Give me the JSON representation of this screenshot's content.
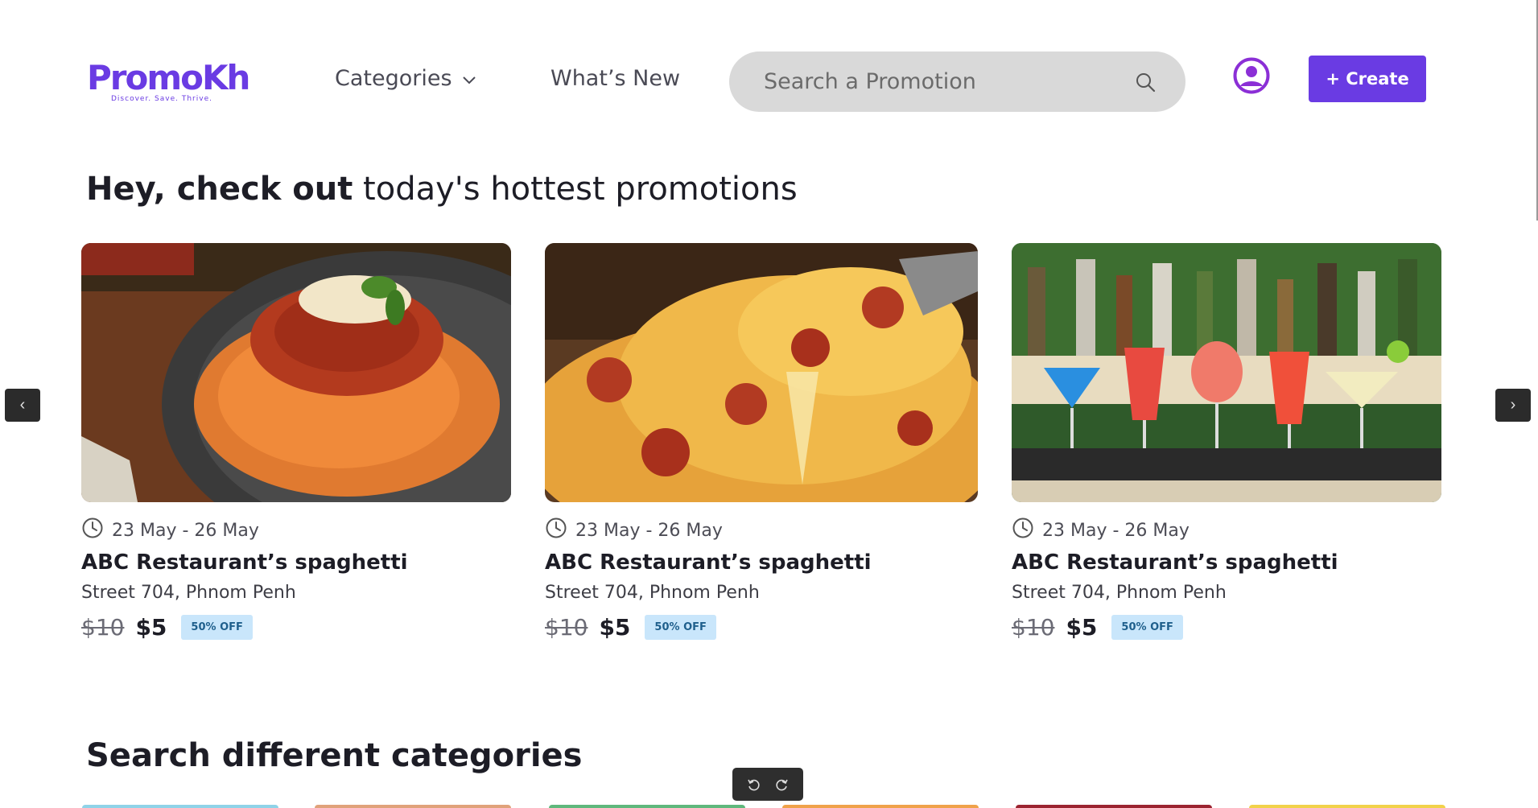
{
  "brand": {
    "name": "PromoKh",
    "tagline": "Discover. Save. Thrive.",
    "color": "#6a3be3"
  },
  "nav": {
    "categories": "Categories",
    "whats_new": "What’s New"
  },
  "search": {
    "placeholder": "Search a Promotion",
    "value": ""
  },
  "header": {
    "create_label": "+ Create"
  },
  "hero": {
    "title_bold": "Hey, check out",
    "title_rest": " today's hottest promotions"
  },
  "carousel": {
    "prev_label": "‹",
    "next_label": "›",
    "cards": [
      {
        "date": "23 May - 26 May",
        "title": "ABC Restaurant’s spaghetti",
        "location": "Street 704, Phnom Penh",
        "old_price": "$10",
        "new_price": "$5",
        "badge": "50% OFF",
        "image": "spaghetti"
      },
      {
        "date": "23 May - 26 May",
        "title": "ABC Restaurant’s spaghetti",
        "location": "Street 704, Phnom Penh",
        "old_price": "$10",
        "new_price": "$5",
        "badge": "50% OFF",
        "image": "pizza"
      },
      {
        "date": "23 May - 26 May",
        "title": "ABC Restaurant’s spaghetti",
        "location": "Street 704, Phnom Penh",
        "old_price": "$10",
        "new_price": "$5",
        "badge": "50% OFF",
        "image": "cocktails"
      }
    ]
  },
  "categories_section": {
    "title": "Search different categories",
    "strip_colors": [
      "#8fd3e8",
      "#e0a27a",
      "#5fb87c",
      "#f0a24a",
      "#9b2430",
      "#f2d24a"
    ]
  },
  "icons": [
    "chevron-down-icon",
    "search-icon",
    "user-circle-icon",
    "clock-icon",
    "undo-icon",
    "redo-icon"
  ]
}
